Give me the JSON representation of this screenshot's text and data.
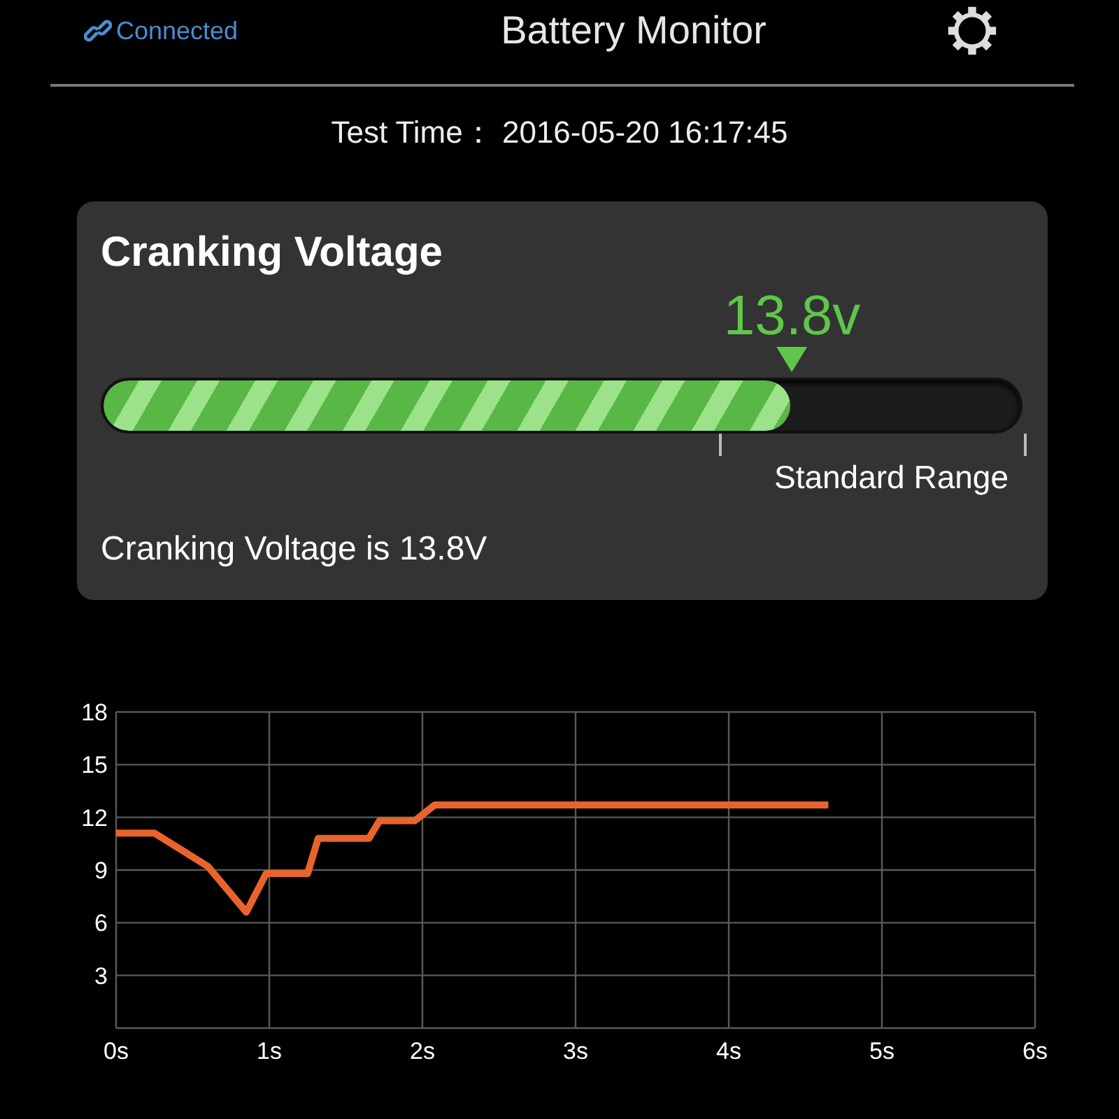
{
  "header": {
    "connection": "Connected",
    "title": "Battery Monitor"
  },
  "test_time": {
    "label": "Test Time：",
    "value": "2016-05-20 16:17:45"
  },
  "card": {
    "title": "Cranking Voltage",
    "reading": "13.8v",
    "level": 0.75,
    "range_label": "Standard Range",
    "summary": "Cranking Voltage is 13.8V"
  },
  "chart": {
    "chart_data": {
      "type": "line",
      "x": [
        0,
        0.25,
        0.6,
        0.85,
        0.98,
        1.25,
        1.32,
        1.65,
        1.72,
        1.95,
        2.08,
        4.65
      ],
      "grid": true,
      "series": [
        {
          "color": "#e8642c",
          "values": [
            11.1,
            11.1,
            9.2,
            6.6,
            8.8,
            8.8,
            10.8,
            10.8,
            11.8,
            11.8,
            12.7,
            12.7
          ]
        }
      ],
      "xlim": [
        0,
        6
      ],
      "ylim": [
        0,
        18
      ],
      "xticks": [
        {
          "value": 0,
          "label": "0s"
        },
        {
          "value": 1,
          "label": "1s"
        },
        {
          "value": 2,
          "label": "2s"
        },
        {
          "value": 3,
          "label": "3s"
        },
        {
          "value": 4,
          "label": "4s"
        },
        {
          "value": 5,
          "label": "5s"
        },
        {
          "value": 6,
          "label": "6s"
        }
      ],
      "yticks": [
        3,
        6,
        9,
        12,
        15,
        18
      ]
    }
  }
}
